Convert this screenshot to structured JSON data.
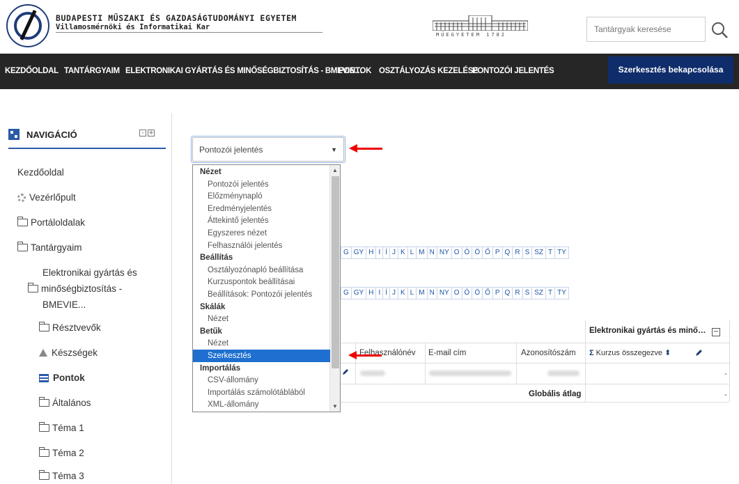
{
  "header": {
    "university": "BUDAPESTI MŰSZAKI ÉS GAZDASÁGTUDOMÁNYI EGYETEM",
    "faculty": "Villamosmérnöki és Informatikai Kar",
    "building_caption": "MŰEGYETEM 1782",
    "search_placeholder": "Tantárgyak keresése"
  },
  "navbar": {
    "items": [
      "KEZDŐOLDAL",
      "TANTÁRGYAIM",
      "ELEKTRONIKAI GYÁRTÁS ÉS MINŐSÉGBIZTOSÍTÁS - BMEVIE…",
      "PONTOK",
      "OSZTÁLYOZÁS KEZELÉSE",
      "PONTOZÓI JELENTÉS"
    ],
    "edit_button": "Szerkesztés bekapcsolása"
  },
  "sidebar": {
    "title": "NAVIGÁCIÓ",
    "items": [
      "Kezdőoldal",
      "Vezérlőpult",
      "Portáloldalak",
      "Tantárgyaim",
      "Elektronikai gyártás és",
      "minőségbiztosítás -",
      "BMEVIE...",
      "Résztvevők",
      "Készségek",
      "Pontok",
      "Általános",
      "Téma 1",
      "Téma 2",
      "Téma 3"
    ]
  },
  "main": {
    "select_value": "Pontozói jelentés",
    "dropdown": [
      {
        "type": "group",
        "label": "Nézet"
      },
      {
        "type": "opt",
        "label": "Pontozói jelentés"
      },
      {
        "type": "opt",
        "label": "Előzménynapló"
      },
      {
        "type": "opt",
        "label": "Eredményjelentés"
      },
      {
        "type": "opt",
        "label": "Áttekintő jelentés"
      },
      {
        "type": "opt",
        "label": "Egyszeres nézet"
      },
      {
        "type": "opt",
        "label": "Felhasználói jelentés"
      },
      {
        "type": "group",
        "label": "Beállítás"
      },
      {
        "type": "opt",
        "label": "Osztályozónapló beállítása"
      },
      {
        "type": "opt",
        "label": "Kurzuspontok beállításai"
      },
      {
        "type": "opt",
        "label": "Beállítások: Pontozói jelentés"
      },
      {
        "type": "group",
        "label": "Skálák"
      },
      {
        "type": "opt",
        "label": "Nézet"
      },
      {
        "type": "group",
        "label": "Betűk"
      },
      {
        "type": "opt",
        "label": "Nézet"
      },
      {
        "type": "opt",
        "label": "Szerkesztés",
        "selected": true
      },
      {
        "type": "group",
        "label": "Importálás"
      },
      {
        "type": "opt",
        "label": "CSV-állomány"
      },
      {
        "type": "opt",
        "label": "Importálás számolótáblából"
      },
      {
        "type": "opt",
        "label": "XML-állomány"
      }
    ],
    "alphabet": [
      "G",
      "GY",
      "H",
      "I",
      "Í",
      "J",
      "K",
      "L",
      "M",
      "N",
      "NY",
      "O",
      "Ó",
      "Ö",
      "Ő",
      "P",
      "Q",
      "R",
      "S",
      "SZ",
      "T",
      "TY"
    ],
    "table": {
      "course_header": "Elektronikai gyártás és minő…",
      "collapse_symbol": "−",
      "col_username": "Felhasználónév",
      "col_email": "E-mail cím",
      "col_id": "Azonosítószám",
      "col_total": "Kurzus összegezve",
      "sigma": "Σ",
      "sort_symbol": "⬍",
      "row_value": "-",
      "avg_label": "Globális átlag",
      "avg_value": "-"
    }
  }
}
